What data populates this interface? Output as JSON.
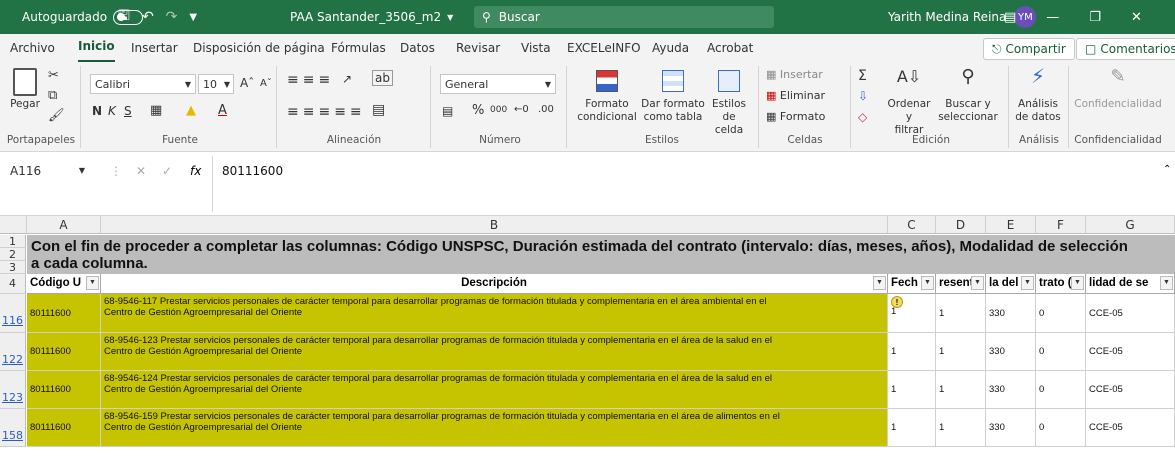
{
  "titlebar": {
    "autosave_label": "Autoguardado",
    "filename": "PAA Santander_3506_m2",
    "search_placeholder": "Buscar",
    "user_name": "Yarith Medina Reina",
    "user_initials": "YM"
  },
  "menu": {
    "items": [
      "Archivo",
      "Inicio",
      "Insertar",
      "Disposición de página",
      "Fórmulas",
      "Datos",
      "Revisar",
      "Vista",
      "EXCELeINFO",
      "Ayuda",
      "Acrobat"
    ],
    "active": "Inicio",
    "share": "Compartir",
    "comments": "Comentarios"
  },
  "ribbon": {
    "paste": "Pegar",
    "font_name": "Calibri",
    "font_size": "10",
    "number_format": "General",
    "conditional_format": [
      "Formato",
      "condicional"
    ],
    "format_table": [
      "Dar formato",
      "como tabla"
    ],
    "cell_styles": [
      "Estilos de",
      "celda"
    ],
    "insert": "Insertar",
    "delete": "Eliminar",
    "format": "Formato",
    "sort_filter": [
      "Ordenar y",
      "filtrar"
    ],
    "find_select": [
      "Buscar y",
      "seleccionar"
    ],
    "analyze": [
      "Análisis",
      "de datos"
    ],
    "confidential": "Confidencialidad",
    "groups": [
      "Portapapeles",
      "Fuente",
      "Alineación",
      "Número",
      "Estilos",
      "Celdas",
      "Edición",
      "Análisis",
      "Confidencialidad"
    ]
  },
  "formula_bar": {
    "name_box": "A116",
    "fx": "fx",
    "value": "80111600"
  },
  "columns": [
    "A",
    "B",
    "C",
    "D",
    "E",
    "F",
    "G"
  ],
  "banner_text": "Con el fin de proceder a completar las columnas: Código UNSPSC, Duración estimada del contrato (intervalo: días, meses, años), Modalidad de selección",
  "banner_text2": "a cada columna.",
  "headers": [
    "Código U",
    "Descripción",
    "Fech",
    "resent",
    "la del",
    "trato (",
    "lidad de se"
  ],
  "rows": [
    {
      "num": "116",
      "code": "80111600",
      "desc1": "68-9546-117 Prestar servicios personales de carácter temporal para desarrollar programas de formación titulada y complementaria en el área ambiental en el",
      "desc2": "Centro de Gestión Agroempresarial del Oriente",
      "c": "1",
      "d": "1",
      "e": "330",
      "f": "0",
      "g": "CCE-05"
    },
    {
      "num": "122",
      "code": "80111600",
      "desc1": "68-9546-123 Prestar servicios personales de carácter temporal para desarrollar programas de formación titulada y complementaria en el área de la salud en el",
      "desc2": "Centro de Gestión Agroempresarial del Oriente",
      "c": "1",
      "d": "1",
      "e": "330",
      "f": "0",
      "g": "CCE-05"
    },
    {
      "num": "123",
      "code": "80111600",
      "desc1": "68-9546-124 Prestar servicios personales de carácter temporal para desarrollar programas de formación titulada y complementaria en el área de la salud en el",
      "desc2": "Centro de Gestión Agroempresarial del Oriente",
      "c": "1",
      "d": "1",
      "e": "330",
      "f": "0",
      "g": "CCE-05"
    },
    {
      "num": "158",
      "code": "80111600",
      "desc1": "68-9546-159 Prestar servicios personales de carácter temporal para desarrollar programas de formación titulada y complementaria en el área de alimentos en el",
      "desc2": "Centro de Gestión Agroempresarial del Oriente",
      "c": "1",
      "d": "1",
      "e": "330",
      "f": "0",
      "g": "CCE-05"
    }
  ],
  "colors": {
    "title_bg": "#217346",
    "highlight": "#c6c400",
    "banner": "#bcbcbc"
  }
}
